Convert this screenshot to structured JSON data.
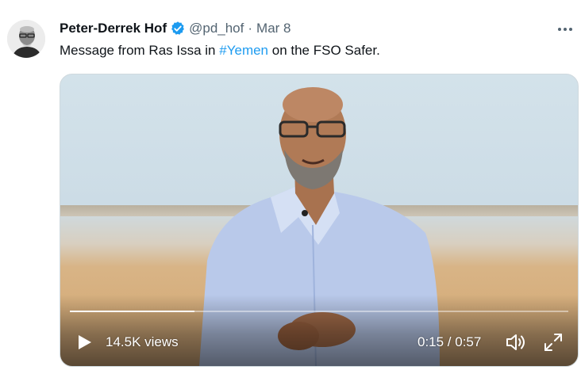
{
  "tweet": {
    "author_name": "Peter-Derrek Hof",
    "handle": "@pd_hof",
    "separator": "·",
    "date": "Mar 8",
    "text_before": "Message from Ras Issa in ",
    "hashtag": "#Yemen",
    "text_after": " on the FSO Safer.",
    "verified_color": "#1d9bf0"
  },
  "video": {
    "views": "14.5K views",
    "time": "0:15 / 0:57",
    "progress": 0.25
  },
  "icons": {
    "verified": "verified-badge-icon",
    "more": "more-dots-icon",
    "play": "play-icon",
    "volume": "volume-icon",
    "fullscreen": "fullscreen-icon"
  }
}
